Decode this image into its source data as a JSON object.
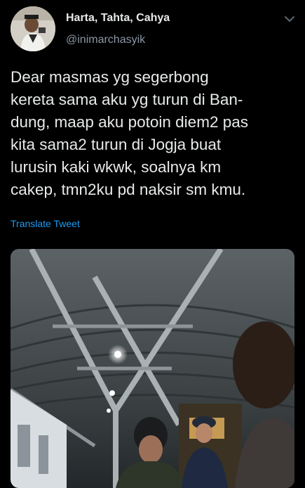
{
  "header": {
    "display_name": "Harta, Tahta, Cahya",
    "handle": "@inimarchasyik",
    "avatar_icon": "avatar",
    "menu_icon": "chevron-down-icon"
  },
  "tweet": {
    "text": "Dear masmas yg segerbong\nkereta sama aku yg turun di Ban-\ndung, maap aku potoin diem2 pas\nkita sama2 turun di Jogja buat\nlurusin kaki wkwk, soalnya km\ncakep, tmn2ku pd naksir sm kmu.",
    "translate_label": "Translate Tweet"
  },
  "media": {
    "type": "photo",
    "description_icon": "train-station-photo"
  },
  "colors": {
    "background": "#000000",
    "text": "#e7e9ea",
    "secondary": "#8b98a5",
    "accent": "#1d9bf0"
  }
}
